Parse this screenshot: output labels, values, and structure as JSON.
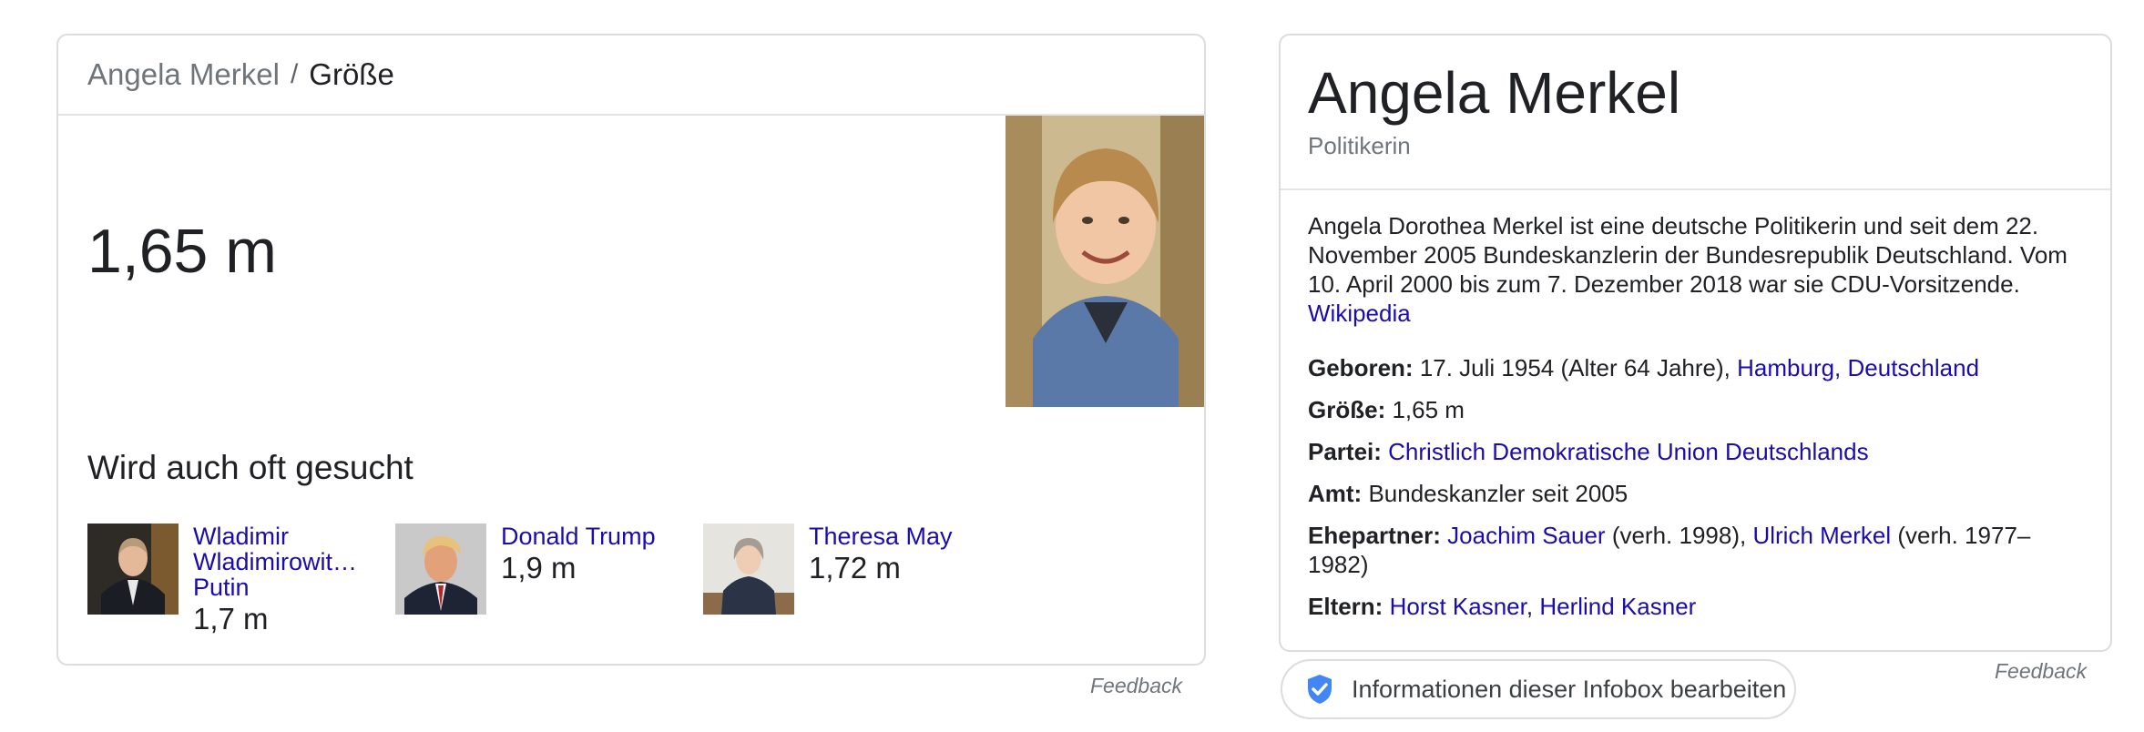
{
  "answer": {
    "breadcrumb": {
      "entity": "Angela Merkel",
      "separator": "/",
      "attribute": "Größe"
    },
    "value": "1,65 m",
    "also_searched_title": "Wird auch oft gesucht",
    "related": [
      {
        "name_line1": "Wladimir",
        "name_line2": "Wladimirowit…",
        "name_line3": "Putin",
        "value": "1,7 m"
      },
      {
        "name_line1": "Donald Trump",
        "value": "1,9 m"
      },
      {
        "name_line1": "Theresa May",
        "value": "1,72 m"
      }
    ],
    "feedback": "Feedback"
  },
  "knowledge_panel": {
    "title": "Angela Merkel",
    "subtitle": "Politikerin",
    "description": "Angela Dorothea Merkel ist eine deutsche Politikerin und seit dem 22. November 2005 Bundeskanzlerin der Bundesrepublik Deutschland. Vom 10. April 2000 bis zum 7. Dezember 2018 war sie CDU-Vorsitzende.",
    "source_link": "Wikipedia",
    "facts": {
      "born": {
        "label": "Geboren:",
        "text": "17. Juli 1954 (Alter 64 Jahre),",
        "link": "Hamburg, Deutschland"
      },
      "height": {
        "label": "Größe:",
        "text": "1,65 m"
      },
      "party": {
        "label": "Partei:",
        "link": "Christlich Demokratische Union Deutschlands"
      },
      "office": {
        "label": "Amt:",
        "text": "Bundeskanzler seit 2005"
      },
      "spouse": {
        "label": "Ehepartner:",
        "link1": "Joachim Sauer",
        "text1": "(verh. 1998),",
        "link2": "Ulrich Merkel",
        "text2": "(verh. 1977–1982)"
      },
      "parents": {
        "label": "Eltern:",
        "link1": "Horst Kasner",
        "sep": ",",
        "link2": "Herlind Kasner"
      }
    },
    "feedback": "Feedback"
  },
  "edit_button": {
    "label": "Informationen dieser Infobox bearbeiten"
  },
  "colors": {
    "link": "#1a0dab",
    "secondary_text": "#70757a",
    "border": "#dadce0",
    "shield": "#4285f4"
  },
  "icons": {
    "edit": "shield-check-icon"
  }
}
